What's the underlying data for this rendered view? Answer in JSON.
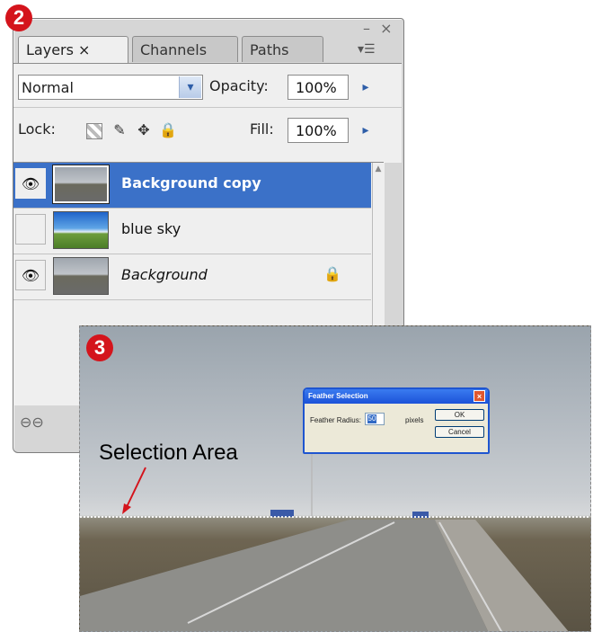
{
  "badges": {
    "panel": "2",
    "photo": "3"
  },
  "window_controls": {
    "minimize": "–",
    "close": "×"
  },
  "tabs": [
    {
      "label": "Layers ×",
      "active": true
    },
    {
      "label": "Channels",
      "active": false
    },
    {
      "label": "Paths",
      "active": false
    }
  ],
  "panel_menu_icon": "▾☰",
  "blend_mode": {
    "value": "Normal",
    "arrow": "▾"
  },
  "opacity": {
    "label": "Opacity:",
    "value": "100%",
    "arrow": "▸"
  },
  "lock": {
    "label": "Lock:",
    "icons": [
      "lock-transparent-icon",
      "brush-icon",
      "move-icon",
      "lock-icon"
    ]
  },
  "lock_glyphs": {
    "brush": "✎",
    "move": "✥",
    "all": "🔒"
  },
  "fill": {
    "label": "Fill:",
    "value": "100%",
    "arrow": "▸"
  },
  "layers": [
    {
      "name": "Background copy",
      "visible": true,
      "selected": true,
      "locked": false
    },
    {
      "name": "blue sky",
      "visible": false,
      "selected": false,
      "locked": false
    },
    {
      "name": "Background",
      "visible": true,
      "selected": false,
      "locked": true
    }
  ],
  "eye_glyph": "👁",
  "layer_lock_glyph": "🔒",
  "footer_link_icon": "⊖⊖",
  "dialog": {
    "title": "Feather Selection",
    "close": "×",
    "radius_label": "Feather Radius:",
    "radius_value": "50",
    "unit": "pixels",
    "ok": "OK",
    "cancel": "Cancel"
  },
  "annotation": {
    "text": "Selection Area"
  },
  "colors": {
    "badge": "#d4141c",
    "selection_highlight": "#3b71c8",
    "xp_title": "#1b52d8"
  }
}
